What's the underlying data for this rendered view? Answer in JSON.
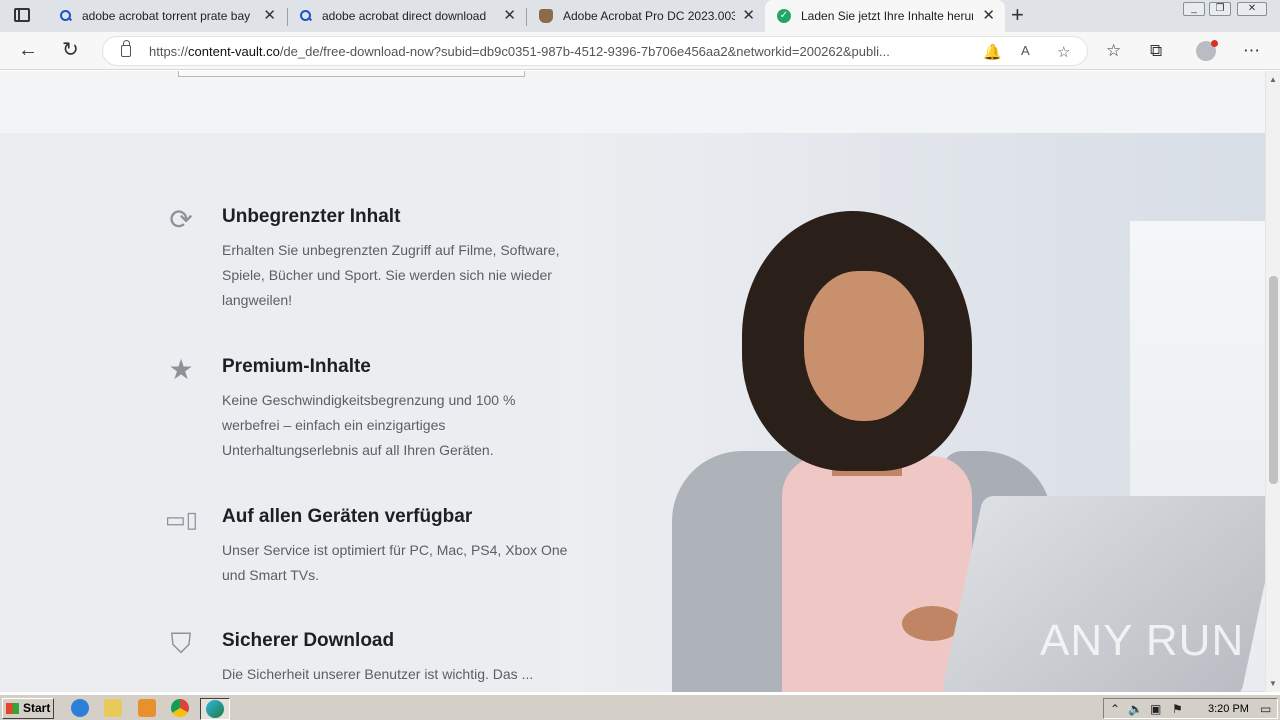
{
  "browser": {
    "tabs": [
      {
        "title": "adobe acrobat torrent prate bay - ",
        "favicon": "search-icon",
        "active": false
      },
      {
        "title": "adobe acrobat direct download p",
        "favicon": "search-icon",
        "active": false
      },
      {
        "title": "Adobe Acrobat Pro DC 2023.003.",
        "favicon": "pirate-ship-icon",
        "active": false
      },
      {
        "title": "Laden Sie jetzt Ihre Inhalte herunt",
        "favicon": "check-circle-icon",
        "active": true
      }
    ],
    "url_host": "content-vault.co",
    "url_path": "/de_de/free-download-now?subid=db9c0351-987b-4512-9396-7b706e456aa2&networkid=200262&publi..."
  },
  "features": [
    {
      "icon": "refresh-icon",
      "title": "Unbegrenzter Inhalt",
      "text": "Erhalten Sie unbegrenzten Zugriff auf Filme, Software, Spiele, Bücher und Sport. Sie werden sich nie wieder langweilen!"
    },
    {
      "icon": "star-icon",
      "title": "Premium-Inhalte",
      "text": "Keine Geschwindigkeitsbegrenzung und 100 % werbefrei – einfach ein einzigartiges Unterhaltungserlebnis auf all Ihren Geräten."
    },
    {
      "icon": "devices-icon",
      "title": "Auf allen Geräten verfügbar",
      "text": "Unser Service ist optimiert für PC, Mac, PS4, Xbox One und Smart TVs."
    },
    {
      "icon": "shield-icon",
      "title": "Sicherer Download",
      "text": "Die Sicherheit unserer Benutzer ist wichtig. Das ..."
    }
  ],
  "watermark": "ANY RUN",
  "taskbar": {
    "start_label": "Start",
    "clock": "3:20 PM"
  },
  "colors": {
    "page_bg": "#ecedf0",
    "heading": "#1d1f24",
    "body_text": "#5b5e66",
    "icon": "#8e9198",
    "active_tab_favicon": "#22a56b"
  }
}
